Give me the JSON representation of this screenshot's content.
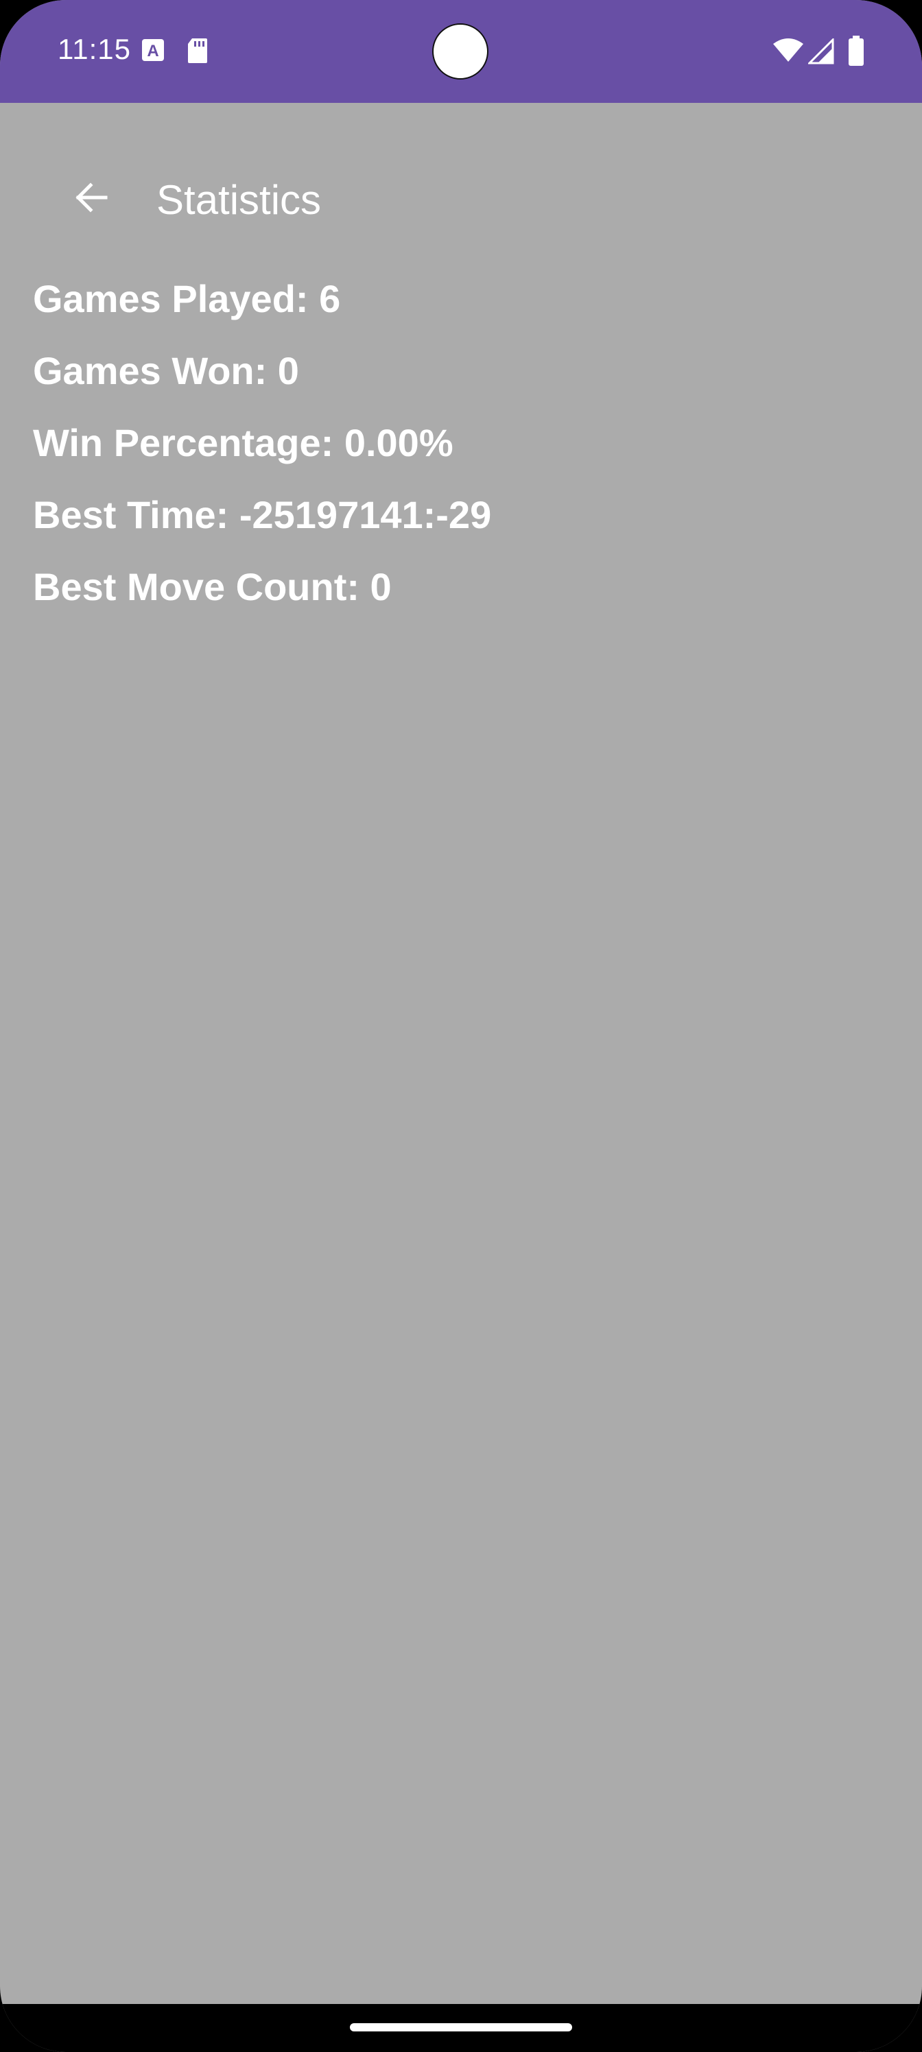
{
  "status_bar": {
    "time": "11:15",
    "background_color": "#684fa5",
    "icons_left": [
      "accessibility-a-icon",
      "sd-card-icon"
    ],
    "icons_right": [
      "wifi-icon",
      "cell-signal-icon",
      "battery-icon"
    ]
  },
  "app_bar": {
    "back_icon": "arrow-back-icon",
    "title": "Statistics"
  },
  "stats": {
    "games_played": "Games Played: 6",
    "games_won": "Games Won: 0",
    "win_percentage": "Win Percentage: 0.00%",
    "best_time": "Best Time: -25197141:-29",
    "best_move_count": "Best Move Count: 0"
  },
  "colors": {
    "background": "#ababab",
    "text": "#ffffff",
    "accent": "#684fa5"
  }
}
